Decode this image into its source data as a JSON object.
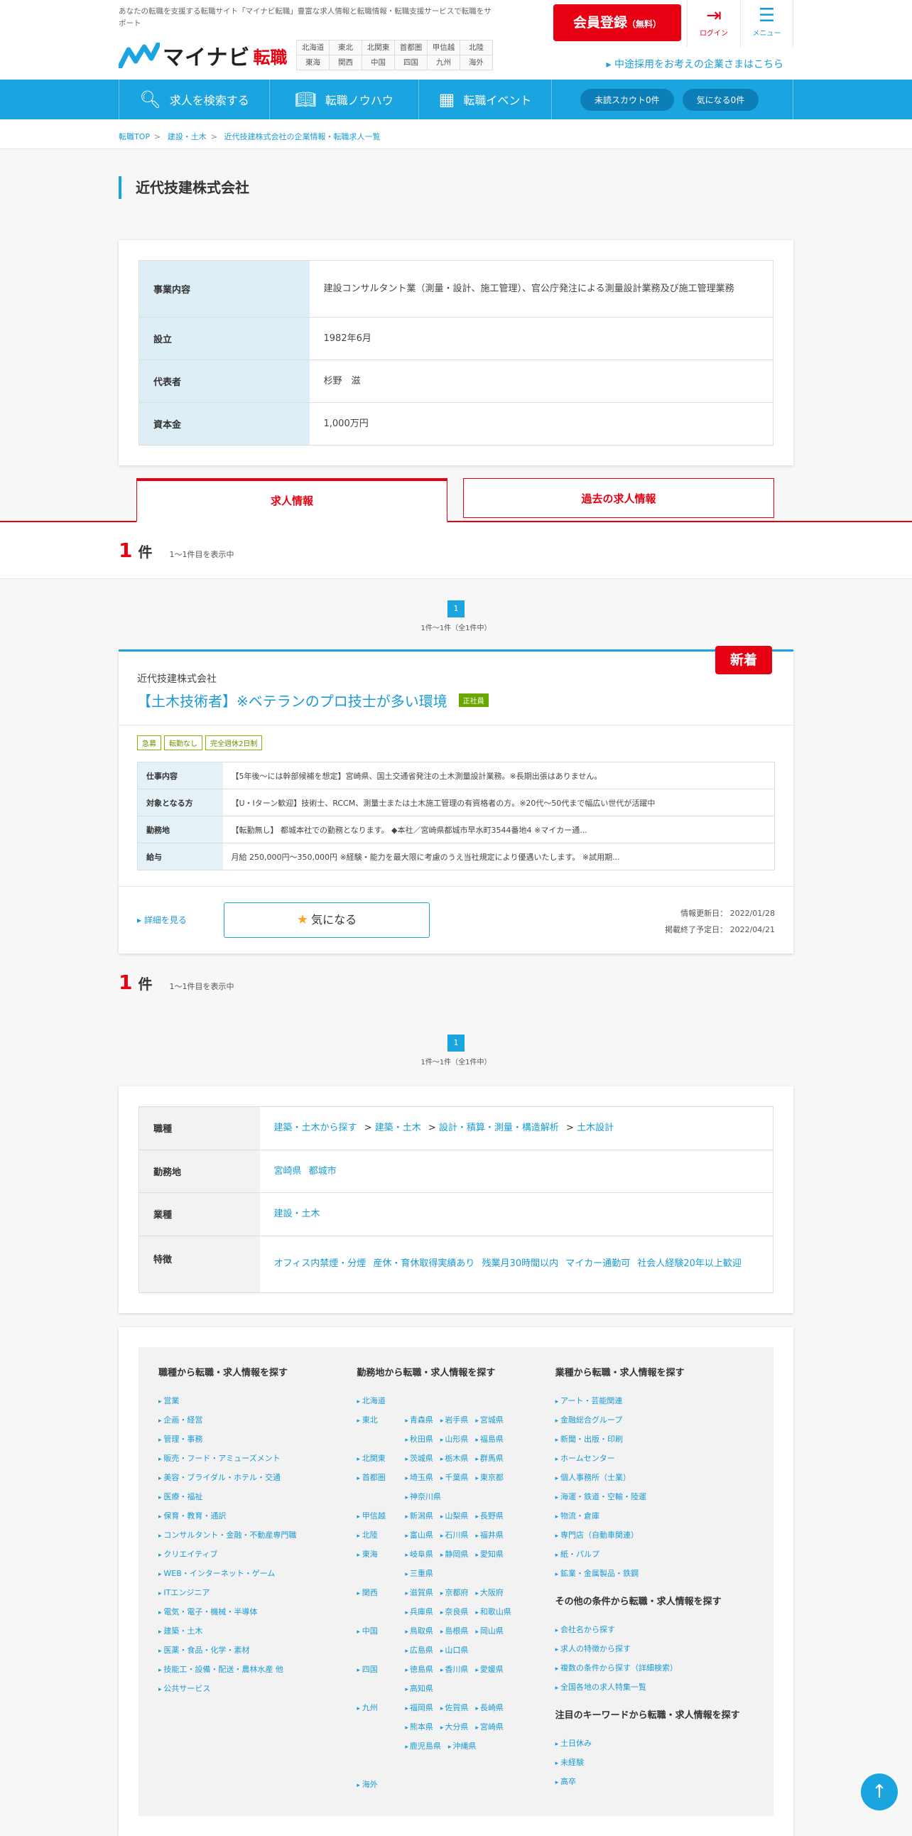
{
  "header": {
    "tagline": "あなたの転職を支援する転職サイト「マイナビ転職」豊富な求人情報と転職情報・転職支援サービスで転職をサポート",
    "logo_main": "マイナビ",
    "logo_sub": "転職",
    "regions": [
      "北海道",
      "東北",
      "北関東",
      "首都圏",
      "甲信越",
      "北陸",
      "東海",
      "関西",
      "中国",
      "四国",
      "九州",
      "海外"
    ],
    "register_label": "会員登録",
    "register_sub": "（無料）",
    "login_label": "ログイン",
    "menu_label": "メニュー",
    "corp_link": "中途採用をお考えの企業さまはこちら"
  },
  "nav": {
    "search": "求人を検索する",
    "knowhow": "転職ノウハウ",
    "event": "転職イベント",
    "scout": "未読スカウト0件",
    "favorite": "気になる0件"
  },
  "breadcrumb": [
    "転職TOP",
    "建設・土木",
    "近代技建株式会社の企業情報・転職求人一覧"
  ],
  "company": {
    "name": "近代技建株式会社",
    "info": [
      {
        "label": "事業内容",
        "value": "建設コンサルタント業（測量・設計、施工管理）、官公庁発注による測量設計業務及び施工管理業務"
      },
      {
        "label": "設立",
        "value": "1982年6月"
      },
      {
        "label": "代表者",
        "value": "杉野　滋"
      },
      {
        "label": "資本金",
        "value": "1,000万円"
      }
    ]
  },
  "tabs": {
    "active": "求人情報",
    "inactive": "過去の求人情報"
  },
  "count": {
    "num": "1",
    "unit": "件",
    "desc": "1〜1件目を表示中"
  },
  "pager": {
    "page": "1",
    "info": "1件〜1件（全1件中）"
  },
  "job": {
    "badge": "新着",
    "company": "近代技建株式会社",
    "title": "【土木技術者】※ベテランのプロ技士が多い環境",
    "emp_type": "正社員",
    "tags": [
      "急募",
      "転勤なし",
      "完全週休2日制"
    ],
    "rows": [
      {
        "label": "仕事内容",
        "value": "【5年後～には幹部候補を想定】宮崎県、国土交通省発注の土木測量設計業務。※長期出張はありません。"
      },
      {
        "label": "対象となる方",
        "value": "【U・Iターン歓迎】技術士、RCCM、測量士または土木施工管理の有資格者の方。※20代～50代まで幅広い世代が活躍中"
      },
      {
        "label": "勤務地",
        "value": "【転勤無し】 都城本社での勤務となります。 ◆本社／宮崎県都城市早水町3544番地4 ※マイカー通..."
      },
      {
        "label": "給与",
        "value": "月給 250,000円〜350,000円 ※経験・能力を最大限に考慮のうえ当社規定により優遇いたします。 ※試用期..."
      }
    ],
    "detail_link": "詳細を見る",
    "fav_label": "気になる",
    "updated": "情報更新日： 2022/01/28",
    "end_date": "掲載終了予定日： 2022/04/21"
  },
  "summary": {
    "rows": [
      {
        "label": "職種",
        "links": [
          "建築・土木から探す",
          "建築・土木",
          "設計・積算・測量・構造解析",
          "土木設計"
        ]
      },
      {
        "label": "勤務地",
        "links": [
          "宮崎県",
          "都城市"
        ]
      },
      {
        "label": "業種",
        "links": [
          "建設・土木"
        ]
      },
      {
        "label": "特徴",
        "links": [
          "オフィス内禁煙・分煙",
          "産休・育休取得実績あり",
          "残業月30時間以内",
          "マイカー通勤可",
          "社会人経験20年以上歓迎"
        ]
      }
    ]
  },
  "footer": {
    "col1": {
      "title": "職種から転職・求人情報を探す",
      "items": [
        "営業",
        "企画・経営",
        "管理・事務",
        "販売・フード・アミューズメント",
        "美容・ブライダル・ホテル・交通",
        "医療・福祉",
        "保育・教育・通訳",
        "コンサルタント・金融・不動産専門職",
        "クリエイティブ",
        "WEB・インターネット・ゲーム",
        "ITエンジニア",
        "電気・電子・機械・半導体",
        "建築・土木",
        "医薬・食品・化学・素材",
        "技能工・設備・配送・農林水産 他",
        "公共サービス"
      ]
    },
    "col2": {
      "title": "勤務地から転職・求人情報を探す",
      "rows": [
        {
          "area": "北海道",
          "prefs": []
        },
        {
          "area": "東北",
          "prefs": [
            "青森県",
            "岩手県",
            "宮城県"
          ]
        },
        {
          "area": "",
          "prefs": [
            "秋田県",
            "山形県",
            "福島県"
          ]
        },
        {
          "area": "北関東",
          "prefs": [
            "茨城県",
            "栃木県",
            "群馬県"
          ]
        },
        {
          "area": "首都圏",
          "prefs": [
            "埼玉県",
            "千葉県",
            "東京都"
          ]
        },
        {
          "area": "",
          "prefs": [
            "神奈川県"
          ]
        },
        {
          "area": "甲信越",
          "prefs": [
            "新潟県",
            "山梨県",
            "長野県"
          ]
        },
        {
          "area": "北陸",
          "prefs": [
            "富山県",
            "石川県",
            "福井県"
          ]
        },
        {
          "area": "東海",
          "prefs": [
            "岐阜県",
            "静岡県",
            "愛知県"
          ]
        },
        {
          "area": "",
          "prefs": [
            "三重県"
          ]
        },
        {
          "area": "関西",
          "prefs": [
            "滋賀県",
            "京都府",
            "大阪府"
          ]
        },
        {
          "area": "",
          "prefs": [
            "兵庫県",
            "奈良県",
            "和歌山県"
          ]
        },
        {
          "area": "中国",
          "prefs": [
            "鳥取県",
            "島根県",
            "岡山県"
          ]
        },
        {
          "area": "",
          "prefs": [
            "広島県",
            "山口県"
          ]
        },
        {
          "area": "四国",
          "prefs": [
            "徳島県",
            "香川県",
            "愛媛県"
          ]
        },
        {
          "area": "",
          "prefs": [
            "高知県"
          ]
        },
        {
          "area": "九州",
          "prefs": [
            "福岡県",
            "佐賀県",
            "長崎県"
          ]
        },
        {
          "area": "",
          "prefs": [
            "熊本県",
            "大分県",
            "宮崎県"
          ]
        },
        {
          "area": "",
          "prefs": [
            "鹿児島県",
            "沖縄県"
          ]
        },
        {
          "area": "",
          "prefs": []
        },
        {
          "area": "海外",
          "prefs": []
        }
      ]
    },
    "col3": {
      "title": "業種から転職・求人情報を探す",
      "items": [
        "アート・芸能関連",
        "金融総合グループ",
        "新聞・出版・印刷",
        "ホームセンター",
        "個人事務所（士業）",
        "海運・鉄道・空輸・陸運",
        "物流・倉庫",
        "専門店（自動車関連）",
        "紙・パルプ",
        "鉱業・金属製品・鉄鋼"
      ],
      "title2": "その他の条件から転職・求人情報を探す",
      "items2": [
        "会社名から探す",
        "求人の特徴から探す",
        "複数の条件から探す（詳細検索）",
        "全国各地の求人特集一覧"
      ],
      "title3": "注目のキーワードから転職・求人情報を探す",
      "items3": [
        "土日休み",
        "未経験",
        "高卒"
      ]
    }
  }
}
